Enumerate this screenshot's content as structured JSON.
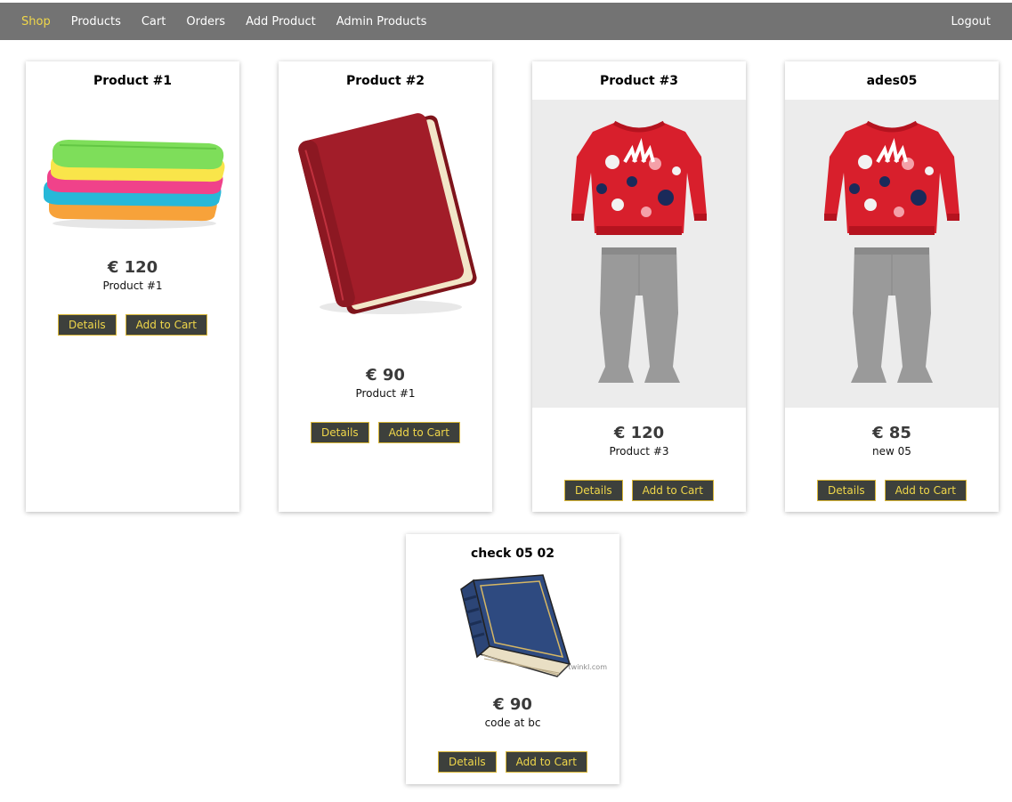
{
  "nav": {
    "items": [
      {
        "label": "Shop",
        "active": true
      },
      {
        "label": "Products"
      },
      {
        "label": "Cart"
      },
      {
        "label": "Orders"
      },
      {
        "label": "Add Product"
      },
      {
        "label": "Admin Products"
      }
    ],
    "logout": "Logout"
  },
  "colors": {
    "navbar": "#737373",
    "active_nav": "#f0d74a",
    "button_bg": "#3d403c",
    "button_text": "#f0d74a"
  },
  "products": [
    {
      "title": "Product #1",
      "price": "€ 120",
      "description": "Product #1",
      "details_label": "Details",
      "cart_label": "Add to Cart",
      "image": "towels-image"
    },
    {
      "title": "Product #2",
      "price": "€ 90",
      "description": "Product #1",
      "details_label": "Details",
      "cart_label": "Add to Cart",
      "image": "red-book-image"
    },
    {
      "title": "Product #3",
      "price": "€ 120",
      "description": "Product #3",
      "details_label": "Details",
      "cart_label": "Add to Cart",
      "image": "tracksuit-image"
    },
    {
      "title": "ades05",
      "price": "€ 85",
      "description": "new 05",
      "details_label": "Details",
      "cart_label": "Add to Cart",
      "image": "tracksuit-image"
    },
    {
      "title": "check 05 02",
      "price": "€ 90",
      "description": "code at bc",
      "details_label": "Details",
      "cart_label": "Add to Cart",
      "image": "blue-book-image",
      "watermark": "twinkl.com"
    }
  ]
}
